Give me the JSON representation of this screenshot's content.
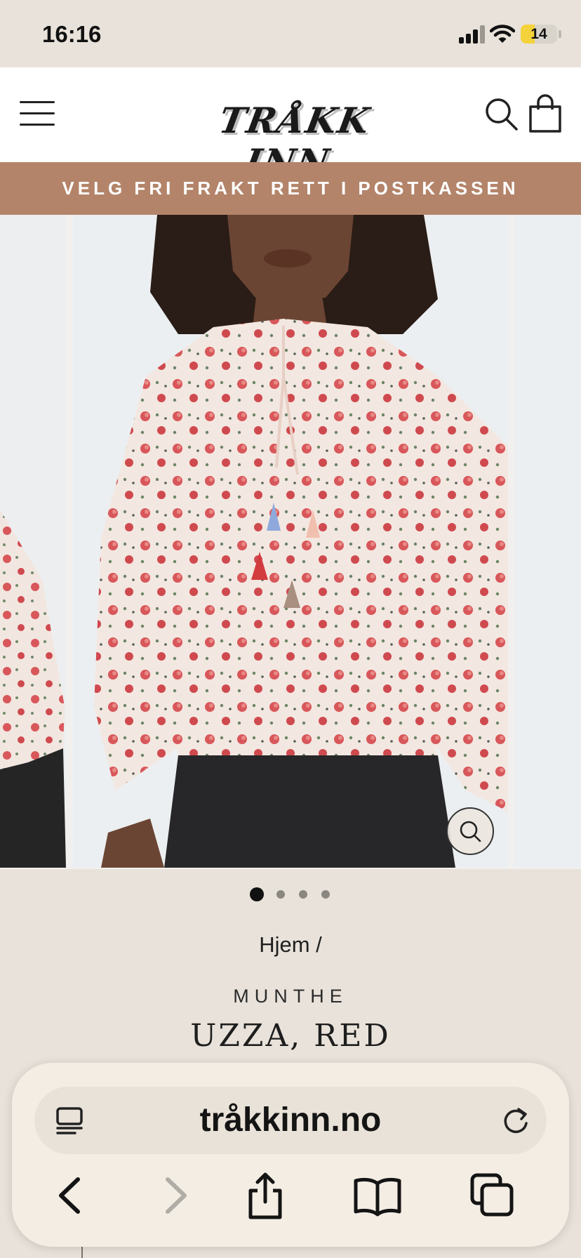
{
  "status_bar": {
    "time": "16:16",
    "battery": "14"
  },
  "header": {
    "logo_text": "TRÅKK INN",
    "icons": [
      "menu-icon",
      "search-icon",
      "cart-icon"
    ]
  },
  "announcement": {
    "text": "VELG FRI FRAKT RETT I POSTKASSEN"
  },
  "gallery": {
    "slide_count": 4,
    "active_slide": 1,
    "zoom_icon": "zoom-icon"
  },
  "product": {
    "breadcrumb": "Hjem /",
    "vendor": "MUNTHE",
    "title": "UZZA, RED"
  },
  "browser": {
    "url": "tråkkinn.no",
    "icons": [
      "reader-icon",
      "reload-icon",
      "back-icon",
      "forward-icon",
      "share-icon",
      "bookmarks-icon",
      "tabs-icon"
    ]
  },
  "colors": {
    "page_bg": "#e8e2da",
    "announcement_bg": "#b3846a",
    "header_bg": "#ffffff",
    "toolbar_bg": "#f3ede4"
  }
}
